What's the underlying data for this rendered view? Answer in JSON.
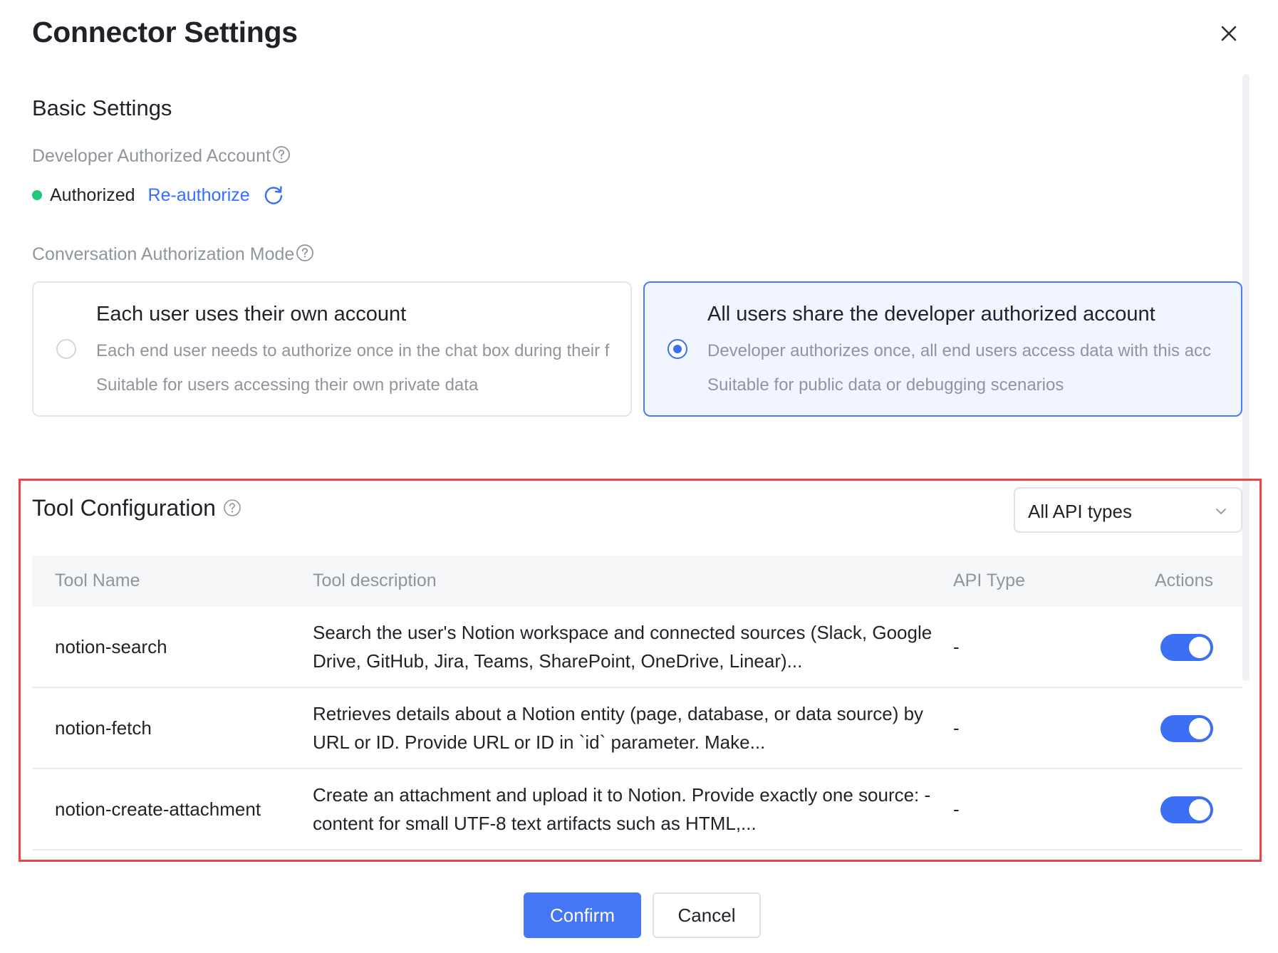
{
  "dialog": {
    "title": "Connector Settings"
  },
  "basic_settings": {
    "section_title": "Basic Settings",
    "developer_account_label": "Developer Authorized Account",
    "auth_status": "Authorized",
    "reauthorize_label": "Re-authorize",
    "status_color": "#21c77a",
    "conversation_mode_label": "Conversation Authorization Mode",
    "modes": [
      {
        "title": "Each user uses their own account",
        "description": "Each end user needs to authorize once in the chat box during their f",
        "note": "Suitable for users accessing their own private data",
        "selected": false
      },
      {
        "title": "All users share the developer authorized account",
        "description": "Developer authorizes once, all end users access data with this acc",
        "note": "Suitable for public data or debugging scenarios",
        "selected": true
      }
    ]
  },
  "tool_configuration": {
    "title": "Tool Configuration",
    "filter": {
      "selected": "All API types"
    },
    "columns": [
      "Tool Name",
      "Tool description",
      "API Type",
      "Actions"
    ],
    "rows": [
      {
        "name": "notion-search",
        "description": "Search the user's Notion workspace and connected sources (Slack, Google Drive, GitHub, Jira, Teams, SharePoint, OneDrive, Linear)...",
        "api_type": "-",
        "enabled": true
      },
      {
        "name": "notion-fetch",
        "description": "Retrieves details about a Notion entity (page, database, or data source) by URL or ID. Provide URL or ID in `id` parameter. Make...",
        "api_type": "-",
        "enabled": true
      },
      {
        "name": "notion-create-attachment",
        "description": "Create an attachment and upload it to Notion. Provide exactly one source: - content for small UTF-8 text artifacts such as HTML,...",
        "api_type": "-",
        "enabled": true
      }
    ]
  },
  "footer": {
    "confirm_label": "Confirm",
    "cancel_label": "Cancel"
  },
  "colors": {
    "accent": "#3d6ff5",
    "link": "#3370ff",
    "highlight_outline": "#e8454b"
  }
}
